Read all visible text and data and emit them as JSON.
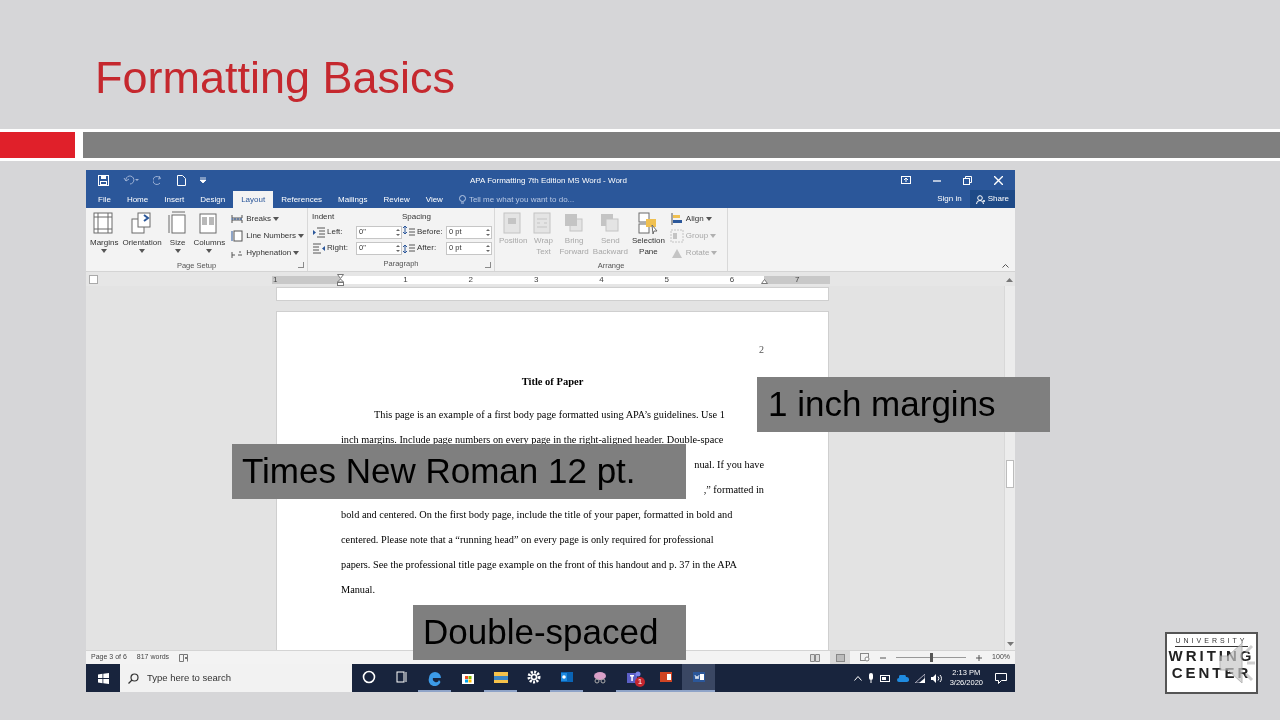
{
  "slide": {
    "title": "Formatting Basics"
  },
  "word": {
    "title": "APA Formatting 7th Edition MS Word - Word",
    "tabs": [
      {
        "label": "File",
        "selected": false
      },
      {
        "label": "Home",
        "selected": false
      },
      {
        "label": "Insert",
        "selected": false
      },
      {
        "label": "Design",
        "selected": false
      },
      {
        "label": "Layout",
        "selected": true
      },
      {
        "label": "References",
        "selected": false
      },
      {
        "label": "Mailings",
        "selected": false
      },
      {
        "label": "Review",
        "selected": false
      },
      {
        "label": "View",
        "selected": false
      }
    ],
    "tell_me": {
      "placeholder": "Tell me what you want to do..."
    },
    "sign_in": "Sign in",
    "share": "Share",
    "ribbon": {
      "page_setup": {
        "label": "Page Setup",
        "large_buttons": [
          {
            "kind": "margins",
            "label": "Margins"
          },
          {
            "kind": "orientation",
            "label": "Orientation"
          },
          {
            "kind": "size",
            "label": "Size"
          },
          {
            "kind": "columns",
            "label": "Columns"
          }
        ],
        "small_buttons": [
          {
            "kind": "breaks",
            "label": "Breaks"
          },
          {
            "kind": "line-numbers",
            "label": "Line Numbers"
          },
          {
            "kind": "hyphenation",
            "label": "Hyphenation"
          }
        ]
      },
      "paragraph": {
        "label": "Paragraph",
        "indent_label": "Indent",
        "spacing_label": "Spacing",
        "fields": [
          {
            "kind": "indent-left",
            "label": "Left:",
            "value": "0\""
          },
          {
            "kind": "spacing-before",
            "label": "Before:",
            "value": "0 pt"
          },
          {
            "kind": "indent-right",
            "label": "Right:",
            "value": "0\""
          },
          {
            "kind": "spacing-after",
            "label": "After:",
            "value": "0 pt"
          }
        ]
      },
      "arrange": {
        "label": "Arrange",
        "large_buttons": [
          {
            "kind": "position",
            "lines": [
              "Position"
            ],
            "disabled": true
          },
          {
            "kind": "wrap",
            "lines": [
              "Wrap",
              "Text"
            ],
            "disabled": true
          },
          {
            "kind": "bring",
            "lines": [
              "Bring",
              "Forward"
            ],
            "disabled": true
          },
          {
            "kind": "send",
            "lines": [
              "Send",
              "Backward"
            ],
            "disabled": true
          },
          {
            "kind": "selection",
            "lines": [
              "Selection",
              "Pane"
            ],
            "disabled": false
          }
        ],
        "small_buttons": [
          {
            "kind": "align",
            "label": "Align",
            "disabled": false
          },
          {
            "kind": "group",
            "label": "Group",
            "disabled": true
          },
          {
            "kind": "rotate",
            "label": "Rotate",
            "disabled": true
          }
        ]
      }
    },
    "ruler": [
      "1",
      "1",
      "2",
      "3",
      "4",
      "5",
      "6",
      "7"
    ],
    "page": {
      "number": "2",
      "title": "Title of Paper",
      "lines": [
        {
          "kind": "first",
          "text": "This page is an example of a first body page formatted using APA’s guidelines. Use 1"
        },
        {
          "kind": "full",
          "text": "inch margins. Include page numbers on every page in the right-aligned header. Double-space"
        },
        {
          "kind": "tail",
          "text": "nual. If you have"
        },
        {
          "kind": "tail",
          "text": ",” formatted in"
        },
        {
          "kind": "full",
          "text": "bold and centered. On the first body page, include the title of your paper, formatted in bold and"
        },
        {
          "kind": "full",
          "text": "centered. Please note that a “running head” on every page is only required for professional"
        },
        {
          "kind": "full",
          "text": "papers. See the professional title page example on the front of this handout and p. 37 in the APA"
        },
        {
          "kind": "full",
          "text": "Manual."
        }
      ]
    },
    "status": {
      "page": "Page 3 of 6",
      "words": "817 words",
      "zoom": {
        "level": 0.5,
        "reading": "100%"
      }
    },
    "taskbar": {
      "search": {
        "placeholder": "Type here to search"
      },
      "apps": [
        {
          "kind": "cortana",
          "running": false,
          "selected": false
        },
        {
          "kind": "taskview",
          "running": false,
          "selected": false
        },
        {
          "kind": "edge",
          "running": true,
          "selected": false
        },
        {
          "kind": "store",
          "running": false,
          "selected": false
        },
        {
          "kind": "explorer",
          "running": true,
          "selected": false
        },
        {
          "kind": "settings",
          "running": false,
          "selected": false
        },
        {
          "kind": "outlook",
          "running": true,
          "selected": false
        },
        {
          "kind": "snip",
          "running": false,
          "selected": false
        },
        {
          "kind": "teams",
          "running": true,
          "selected": false,
          "badge": "1"
        },
        {
          "kind": "powerpoint",
          "running": true,
          "selected": false
        },
        {
          "kind": "word",
          "running": true,
          "selected": true
        }
      ],
      "time": "2:13 PM",
      "date": "3/26/2020"
    }
  },
  "callouts": [
    {
      "text": "1 inch margins"
    },
    {
      "text": "Times New Roman 12 pt."
    },
    {
      "text": "Double-spaced"
    }
  ],
  "logo": {
    "lines": [
      "UNIVERSITY",
      "WRITING",
      "CENTER"
    ]
  }
}
